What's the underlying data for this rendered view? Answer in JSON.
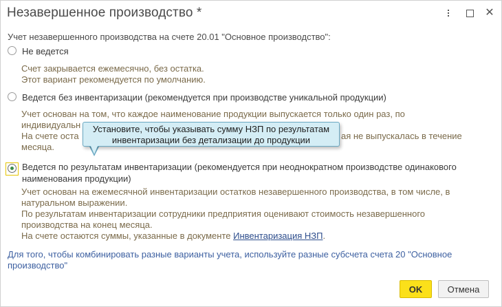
{
  "window": {
    "title": "Незавершенное производство *",
    "menu_icon": "more-vertical-icon",
    "maximize_icon": "maximize-icon",
    "close_icon": "close-icon",
    "close_glyph": "✕"
  },
  "form": {
    "heading": "Учет незавершенного производства на счете 20.01 \"Основное производство\":",
    "options": [
      {
        "label": "Не ведется",
        "checked": false,
        "description": [
          "Счет закрывается ежемесячно, без остатка.",
          "Этот вариант рекомендуется по умолчанию."
        ]
      },
      {
        "label": "Ведется без инвентаризации (рекомендуется при производстве уникальной продукции)",
        "checked": false,
        "description": [
          "Учет основан на том, что каждое наименование продукции выпускается только один раз, по",
          "индивидуальн",
          "На счете оста",
          "ая не выпускалась в течение",
          "месяца."
        ]
      },
      {
        "label_line1": "Ведется по результатам инвентаризации (рекомендуется при неоднократном производстве одинакового",
        "label_line2": "наименования продукции)",
        "checked": true,
        "description": [
          "Учет основан на ежемесячной инвентаризации остатков незавершенного производства, в том числе, в",
          "натуральном выражении.",
          "По результатам инвентаризации сотрудники предприятия оценивают стоимость незавершенного",
          "производства на конец месяца.",
          "На счете остаются суммы, указанные в документе "
        ],
        "link": "Инвентаризация НЗП",
        "after_link": "."
      }
    ],
    "note_line1": "Для того, чтобы комбинировать разные варианты учета, используйте разные субсчета счета 20 \"Основное",
    "note_line2": "производство\""
  },
  "tooltip": {
    "line1": "Установите, чтобы указывать сумму НЗП по результатам",
    "line2": "инвентаризации без детализации до продукции"
  },
  "buttons": {
    "ok": "OK",
    "cancel": "Отмена"
  },
  "colors": {
    "ok_button": "#fbe01a",
    "tooltip_bg": "#d4edf5",
    "note_text": "#3c5fa0",
    "link": "#2d4d8c",
    "radio_checked": "#3c8c4a"
  }
}
